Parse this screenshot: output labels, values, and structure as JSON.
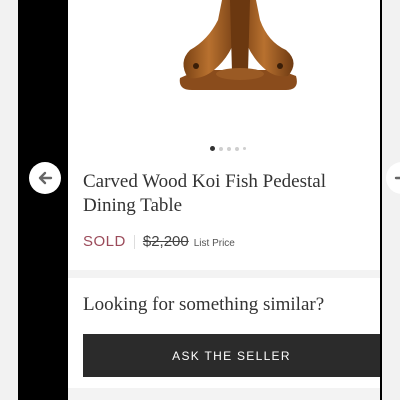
{
  "product": {
    "title": "Carved Wood Koi Fish Pedestal Dining Table",
    "status": "SOLD",
    "price": "$2,200",
    "price_label": "List Price",
    "image_name": "koi-fish-pedestal-table"
  },
  "gallery": {
    "total_dots": 5,
    "active_index": 0
  },
  "similar": {
    "heading": "Looking for something similar?",
    "button_label": "ASK THE SELLER"
  },
  "icons": {
    "prev": "chevron-left-icon",
    "next": "chevron-right-icon"
  },
  "colors": {
    "sold": "#9b4b5a",
    "button_bg": "#2b2b2b",
    "wood": "#a9652b"
  }
}
